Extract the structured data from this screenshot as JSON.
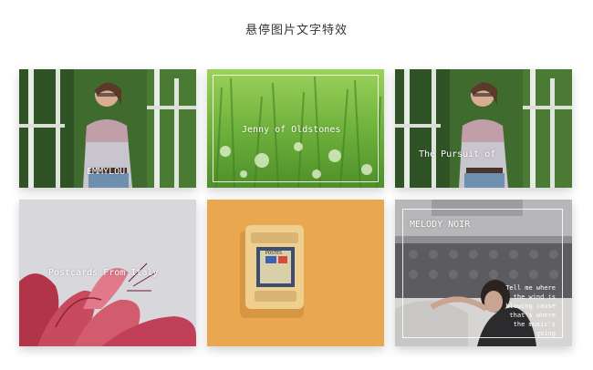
{
  "page": {
    "title": "悬停图片文字特效"
  },
  "cards": [
    {
      "caption": "EMMYLOU"
    },
    {
      "caption": "Jenny of Oldstones"
    },
    {
      "caption": "The Pursuit of"
    },
    {
      "caption": "Postcards From Italy"
    },
    {
      "caption": "",
      "sign_text": "POSTES"
    },
    {
      "caption": "MELODY NOIR",
      "paragraph": [
        "Tell me where",
        "the wind is",
        "blowing cause",
        "that's where",
        "the music's",
        "going"
      ]
    }
  ],
  "colors": {
    "background": "#ffffff",
    "title_text": "#333333",
    "caption_text": "#ffffff",
    "orange_wall": "#e9a84f",
    "grass_green": "#7cc047",
    "flower_pink": "#c63b54"
  }
}
